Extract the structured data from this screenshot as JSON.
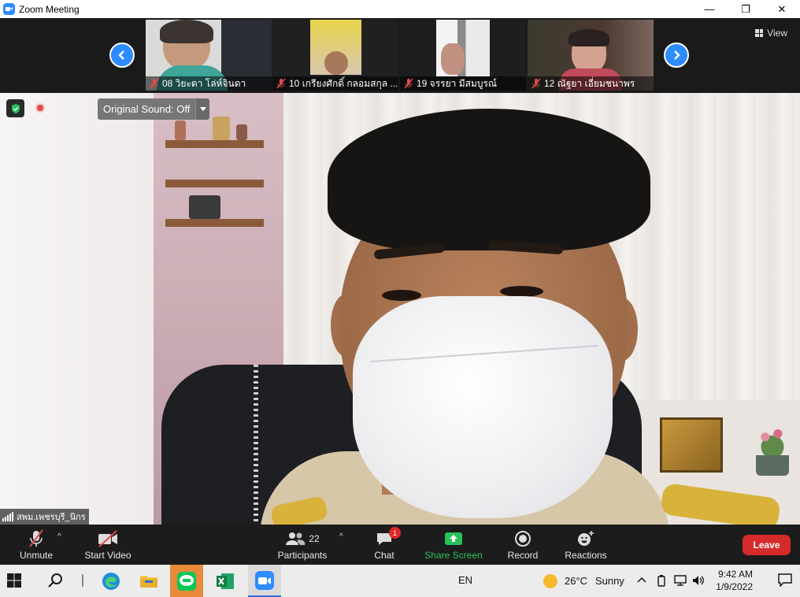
{
  "window": {
    "title": "Zoom Meeting",
    "controls": {
      "minimize": "—",
      "maximize": "❐",
      "close": "✕"
    }
  },
  "gallery": {
    "participants": [
      {
        "name": "08 วิยะดา  โล่ห์จินดา",
        "muted": true
      },
      {
        "name": "10 เกรียงศักดิ์  กลอมสกุล ...",
        "muted": true
      },
      {
        "name": "19 จรรยา  มีสมบูรณ์",
        "muted": true
      },
      {
        "name": "12 ณัฐยา  เอี่ยมชนาพร",
        "muted": true
      }
    ],
    "view_label": "View"
  },
  "main": {
    "original_sound_label": "Original Sound: Off",
    "speaker_name": "สพม.เพชรบุรี_นิกร"
  },
  "toolbar": {
    "unmute_label": "Unmute",
    "start_video_label": "Start Video",
    "participants_label": "Participants",
    "participants_count": "22",
    "chat_label": "Chat",
    "chat_badge": "1",
    "share_screen_label": "Share Screen",
    "record_label": "Record",
    "reactions_label": "Reactions",
    "leave_label": "Leave"
  },
  "taskbar": {
    "language": "EN",
    "weather_temp": "26°C",
    "weather_desc": "Sunny",
    "time": "9:42 AM",
    "date": "1/9/2022"
  },
  "colors": {
    "zoom_blue": "#2d8cff",
    "leave_red": "#d62b2b",
    "share_green": "#27c25a"
  }
}
